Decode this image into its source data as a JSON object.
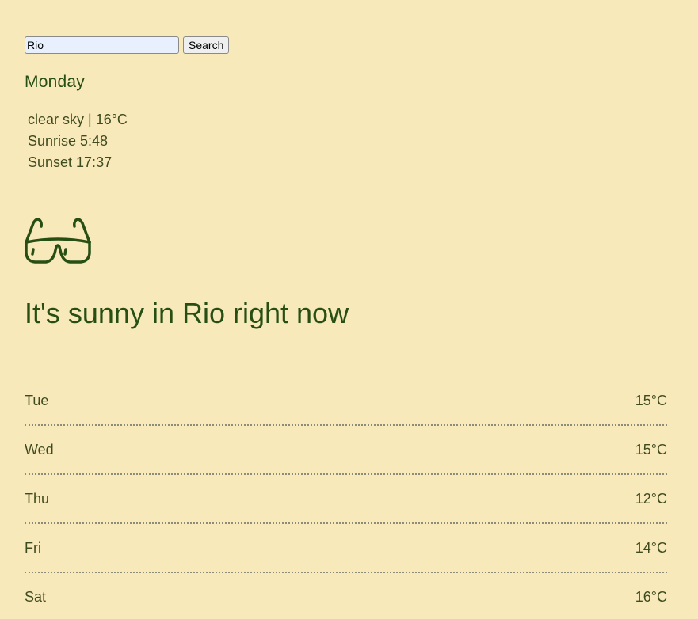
{
  "search": {
    "value": "Rio",
    "button_label": "Search"
  },
  "current": {
    "day": "Monday",
    "description": "clear sky | 16°C",
    "sunrise": "Sunrise 5:48",
    "sunset": "Sunset 17:37",
    "icon": "sunglasses-icon",
    "headline": "It's sunny in Rio right now"
  },
  "forecast": [
    {
      "day": "Tue",
      "temp": "15°C"
    },
    {
      "day": "Wed",
      "temp": "15°C"
    },
    {
      "day": "Thu",
      "temp": "12°C"
    },
    {
      "day": "Fri",
      "temp": "14°C"
    },
    {
      "day": "Sat",
      "temp": "16°C"
    }
  ],
  "colors": {
    "background": "#f8e9bb",
    "accent": "#274f14",
    "text": "#3e4a1f"
  }
}
